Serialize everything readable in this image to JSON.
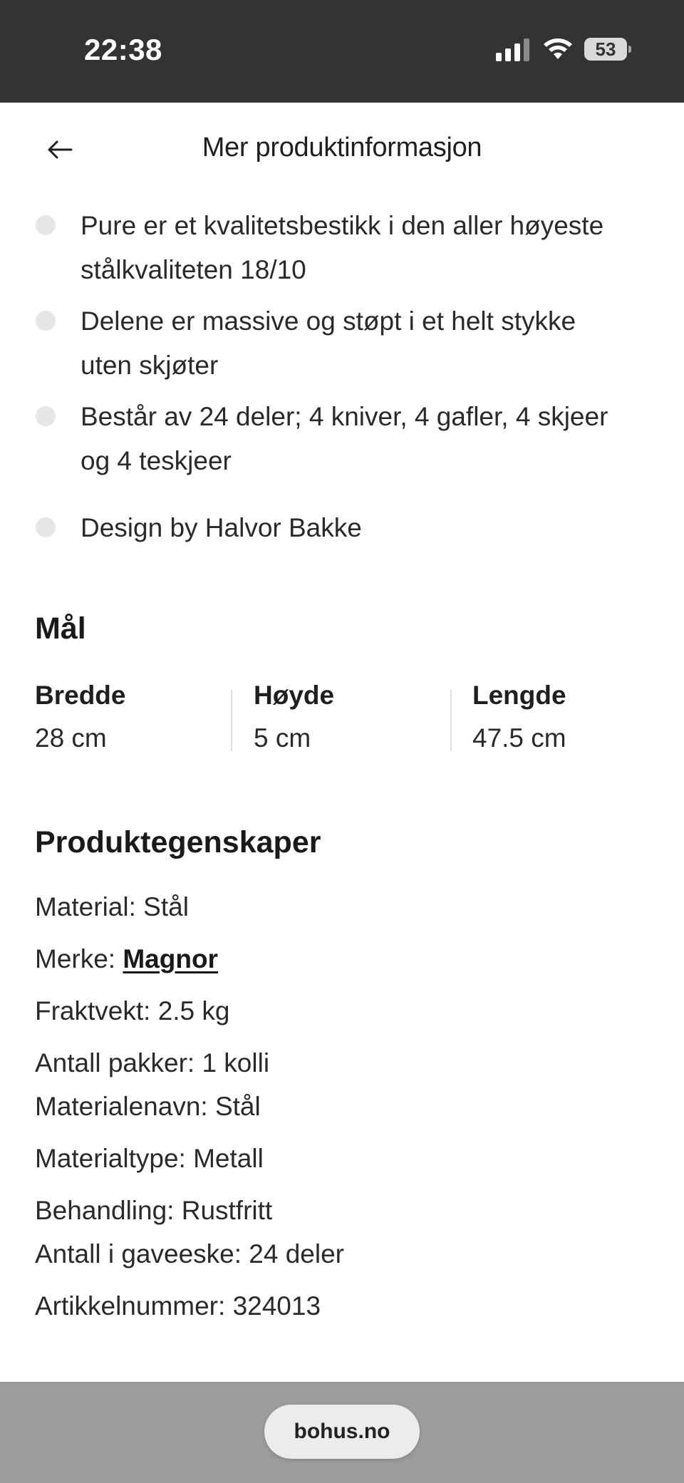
{
  "status_bar": {
    "time": "22:38",
    "battery": "53"
  },
  "header": {
    "title": "Mer produktinformasjon"
  },
  "bullets": [
    {
      "line1": "Pure er et kvalitetsbestikk i den aller høyeste",
      "line2": "stålkvaliteten 18/10"
    },
    {
      "line1": "Delene er massive og støpt i et helt stykke",
      "line2": "uten skjøter"
    },
    {
      "line1": "Består av 24 deler; 4 kniver, 4 gafler, 4 skjeer",
      "line2": "og 4 teskjeer"
    },
    {
      "line1": "Design by Halvor Bakke",
      "line2": ""
    }
  ],
  "dimensions": {
    "heading": "Mål",
    "columns": [
      {
        "label": "Bredde",
        "value": "28 cm"
      },
      {
        "label": "Høyde",
        "value": "5 cm"
      },
      {
        "label": "Lengde",
        "value": "47.5 cm"
      }
    ]
  },
  "properties": {
    "heading": "Produktegenskaper",
    "items": [
      {
        "label": "Material:",
        "value": "Stål"
      },
      {
        "label": "Merke:",
        "value": "Magnor"
      },
      {
        "label": "Fraktvekt:",
        "value": "2.5 kg"
      },
      {
        "label": "Antall pakker:",
        "value": "1 kolli"
      },
      {
        "label": "Materialenavn:",
        "value": "Stål"
      },
      {
        "label": "Materialtype:",
        "value": "Metall"
      },
      {
        "label": "Behandling:",
        "value": "Rustfritt"
      },
      {
        "label": "Antall i gaveeske:",
        "value": "24 deler"
      },
      {
        "label": "Artikkelnummer:",
        "value": "324013"
      }
    ]
  },
  "browser": {
    "url": "bohus.no"
  },
  "icons": {
    "back": "arrow-left-icon",
    "signal": "cellular-signal-icon",
    "wifi": "wifi-icon",
    "battery": "battery-icon"
  }
}
